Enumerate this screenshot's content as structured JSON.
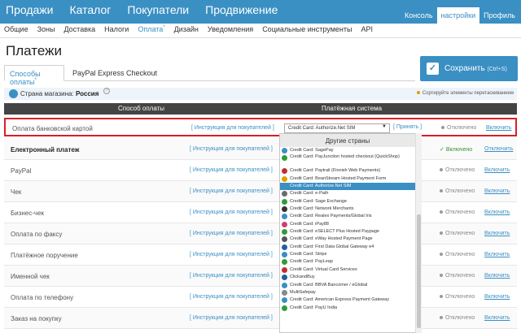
{
  "topbar": {
    "nav": [
      "Продажи",
      "Каталог",
      "Покупатели",
      "Продвижение"
    ],
    "right": [
      "Консоль",
      "настройки",
      "Профиль"
    ]
  },
  "subnav": [
    "Общие",
    "Зоны",
    "Доставка",
    "Налоги",
    "Оплата",
    "Дизайн",
    "Уведомления",
    "Социальные инструменты",
    "API"
  ],
  "page_title": "Платежи",
  "tabs": {
    "tab1": "Способы оплаты",
    "tab2": "PayPal Express Checkout"
  },
  "save": {
    "label": "Сохранить",
    "hint": "(Ctrl+S)"
  },
  "store": {
    "label": "Страна магазина:",
    "country": "Россия",
    "sort_hint": "Сортируйте элементы перетаскиванием"
  },
  "table": {
    "col1": "Способ оплаты",
    "col2": "Платёжная система",
    "rows": [
      {
        "name": "Оплата банковской картой",
        "link": "[ Инструкция для покупателей ]",
        "status": "Отключено",
        "action": "Включить"
      },
      {
        "name": "Електронный платеж",
        "link": "[ Инструкция для покупателей ]",
        "status": "Включено",
        "action": "Отключить"
      },
      {
        "name": "PayPal",
        "link": "[ Инструкция для покупателей ]",
        "status": "Отключено",
        "action": "Включить"
      },
      {
        "name": "Чек",
        "link": "[ Инструкция для покупателей ]",
        "status": "Отключено",
        "action": "Включить"
      },
      {
        "name": "Бизнес-чек",
        "link": "[ Инструкция для покупателей ]",
        "status": "Отключено",
        "action": "Включить"
      },
      {
        "name": "Оплата по факсу",
        "link": "[ Инструкция для покупателей ]",
        "status": "Отключено",
        "action": "Включить"
      },
      {
        "name": "Платёжное поручение",
        "link": "[ Инструкция для покупателей ]",
        "status": "Отключено",
        "action": "Включить"
      },
      {
        "name": "Именной чек",
        "link": "[ Инструкция для покупателей ]",
        "status": "Отключено",
        "action": "Включить"
      },
      {
        "name": "Оплата по телефону",
        "link": "[ Инструкция для покупателей ]",
        "status": "Отключено",
        "action": "Включить"
      },
      {
        "name": "Заказ на покупку",
        "link": "[ Инструкция для покупателей ]",
        "status": "Отключено",
        "action": "Включить"
      }
    ]
  },
  "gateway_select": {
    "value": "Credit Card: Authorize.Net SIM",
    "apply": "[ Принять ]"
  },
  "dropdown": {
    "header": "Другие страны",
    "options": [
      "Credit Card: SagePay",
      "Credit Card: PayJunction hosted checkout (QuickShop)",
      "Credit Card: Paytrail (Finnish Web Payments)",
      "Credit Card: BeanStream Hosted Payment Form",
      "Credit Card: Authorize.Net SIM",
      "Credit Card: e-Path",
      "Credit Card: Sage Exchange",
      "Credit Card: Network Merchants",
      "Credit Card: Realex Payments/Global Iris",
      "Credit Card: iPay88",
      "Credit Card: eSELECT Plus Hosted Paypage",
      "Credit Card: eWay Hosted Payment Page",
      "Credit Card: First Data Global Gateway e4",
      "Credit Card: Stripe",
      "Credit Card: PayLeap",
      "Credit Card: Virtual Card Services",
      "ClickandBuy",
      "Credit Card: BBVA Bancomer / eGlobal",
      "MultiSafepay",
      "Credit Card: American Express Payment Gateway",
      "Credit Card: PayU India"
    ],
    "icon_colors": [
      "#3a8fc3",
      "#2e9c3a",
      "#c03030",
      "#e0a000",
      "#3a8fc3",
      "#6a6a6a",
      "#2e9c3a",
      "#333333",
      "#3a8fc3",
      "#d04070",
      "#2e9c3a",
      "#555555",
      "#2060a0",
      "#3a8fc3",
      "#2e9c3a",
      "#c03030",
      "#2060a0",
      "#3a8fc3",
      "#888888",
      "#3a8fc3",
      "#2e9c3a"
    ]
  },
  "colors": {
    "accent": "#3a8fc3",
    "highlight_border": "#d81f26"
  }
}
